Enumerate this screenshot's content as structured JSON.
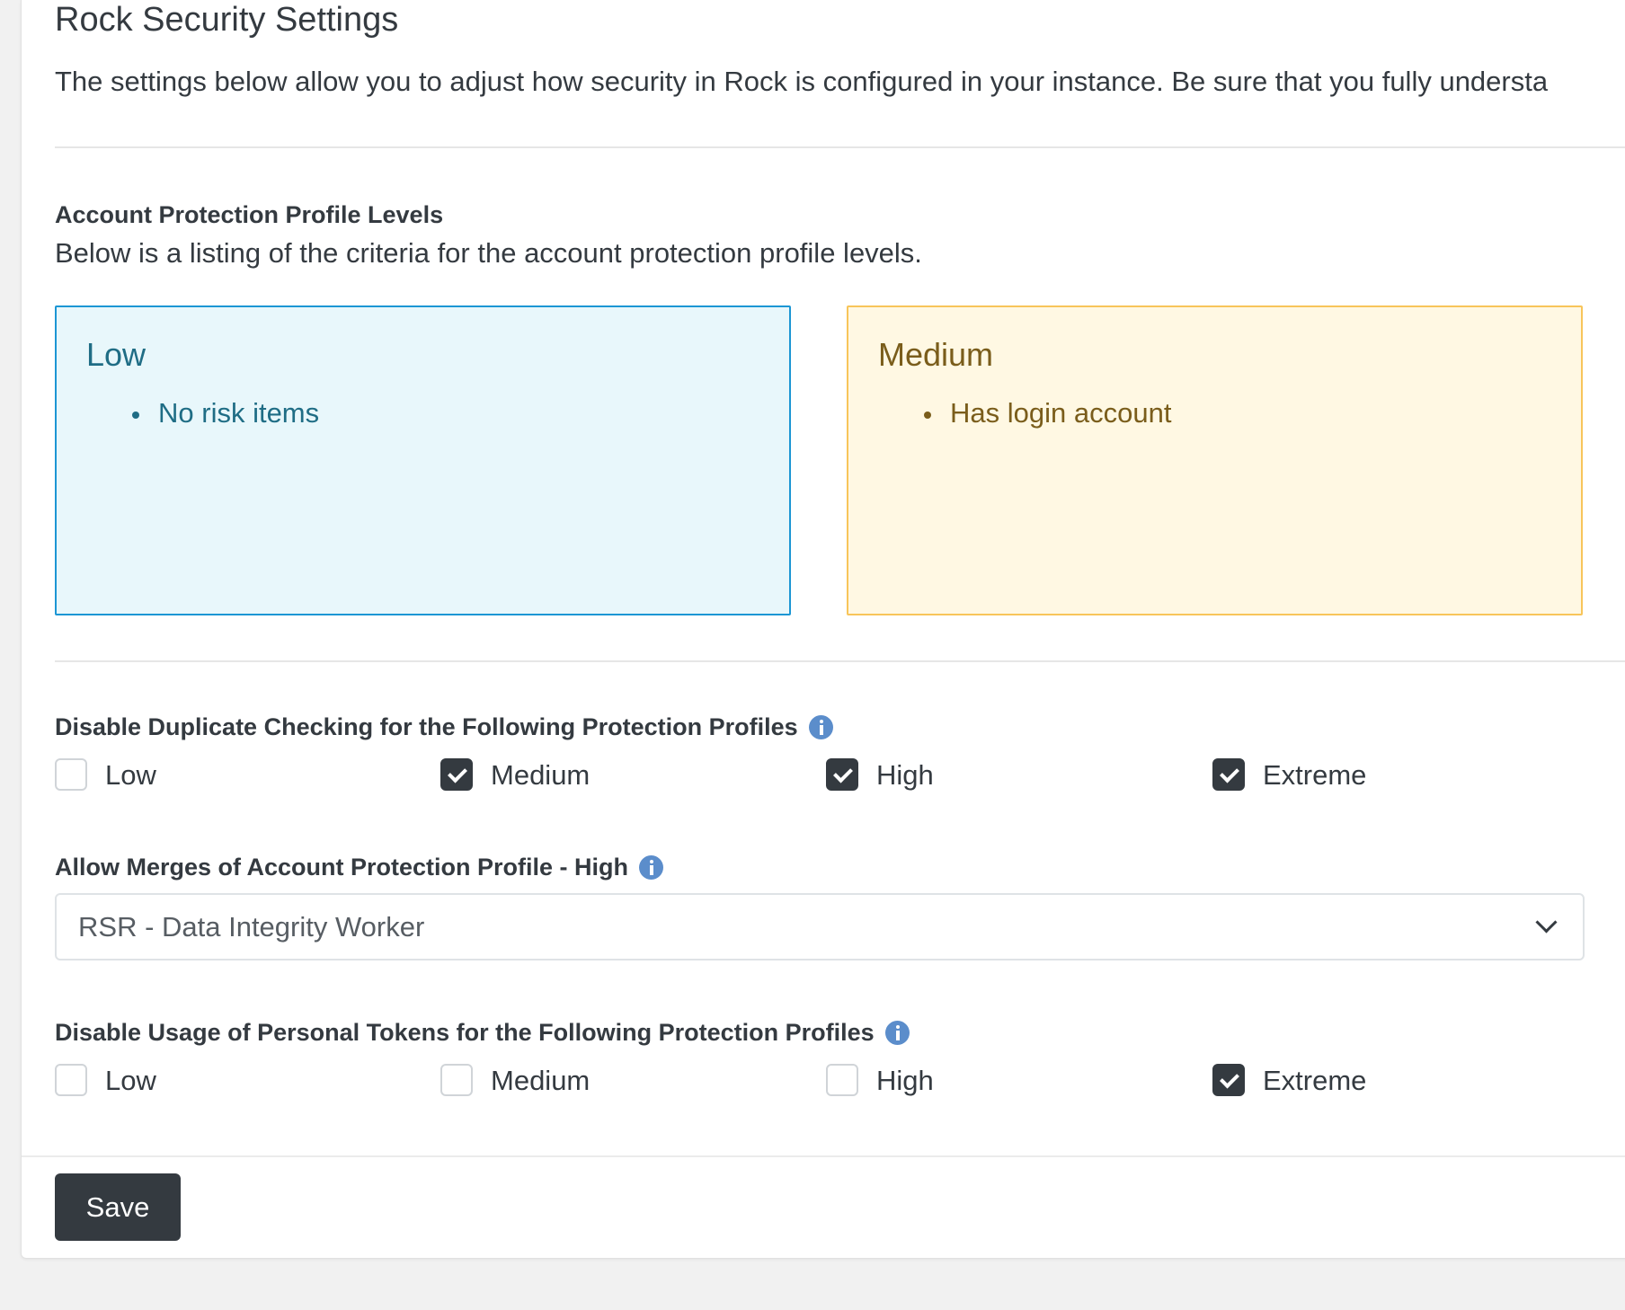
{
  "page": {
    "title": "Rock Security Settings",
    "intro": "The settings below allow you to adjust how security in Rock is configured in your instance. Be sure that you fully understa"
  },
  "profile_levels": {
    "label": "Account Protection Profile Levels",
    "description": "Below is a listing of the criteria for the account protection profile levels.",
    "levels": [
      {
        "name": "Low",
        "items": [
          "No risk items"
        ],
        "color": "#1f6d85",
        "background": "#e8f7fb",
        "border": "#1c96d4"
      },
      {
        "name": "Medium",
        "items": [
          "Has login account"
        ],
        "color": "#7a5d1b",
        "background": "#fff8e3",
        "border": "#f8c55a"
      }
    ]
  },
  "duplicate_checking": {
    "label": "Disable Duplicate Checking for the Following Protection Profiles",
    "icon": "info-icon",
    "options": [
      {
        "label": "Low",
        "checked": false
      },
      {
        "label": "Medium",
        "checked": true
      },
      {
        "label": "High",
        "checked": true
      },
      {
        "label": "Extreme",
        "checked": true
      }
    ]
  },
  "allow_merges": {
    "label": "Allow Merges of Account Protection Profile - High",
    "icon": "info-icon",
    "selected": "RSR - Data Integrity Worker"
  },
  "personal_tokens": {
    "label": "Disable Usage of Personal Tokens for the Following Protection Profiles",
    "icon": "info-icon",
    "options": [
      {
        "label": "Low",
        "checked": false
      },
      {
        "label": "Medium",
        "checked": false
      },
      {
        "label": "High",
        "checked": false
      },
      {
        "label": "Extreme",
        "checked": true
      }
    ]
  },
  "actions": {
    "save_label": "Save"
  }
}
